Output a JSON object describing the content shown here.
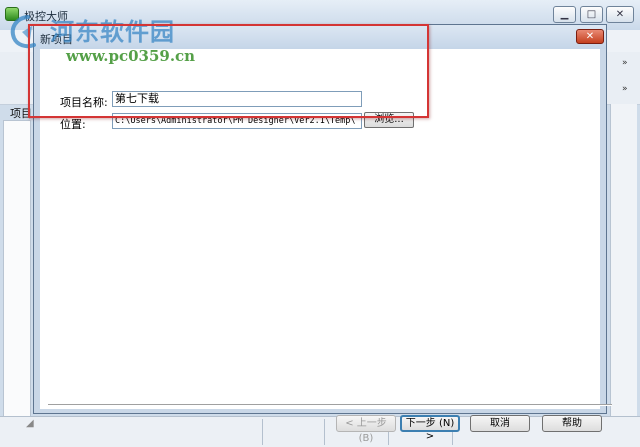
{
  "main_window": {
    "title": "极控大师",
    "background_label": "项目",
    "toolbar_overflow_glyph": "»",
    "resize_grip_glyph": "◢"
  },
  "dialog": {
    "title": "新项目",
    "close_glyph": "✕",
    "fields": {
      "name_label": "项目名称:",
      "name_value": "第七下载",
      "location_label": "位置:",
      "location_value": "C:\\Users\\Administrator\\PM Designer\\Ver2.1\\Temp\\",
      "browse_label": "浏览..."
    },
    "buttons": {
      "prev": "< 上一步 (B)",
      "next": "下一步 (N) >",
      "cancel": "取消",
      "help": "帮助"
    }
  },
  "watermark": {
    "title": "河东软件园",
    "url": "www.pc0359.cn"
  },
  "colors": {
    "highlight": "#d43535",
    "watermark_blue": "#3484c4",
    "watermark_green": "#429634"
  }
}
